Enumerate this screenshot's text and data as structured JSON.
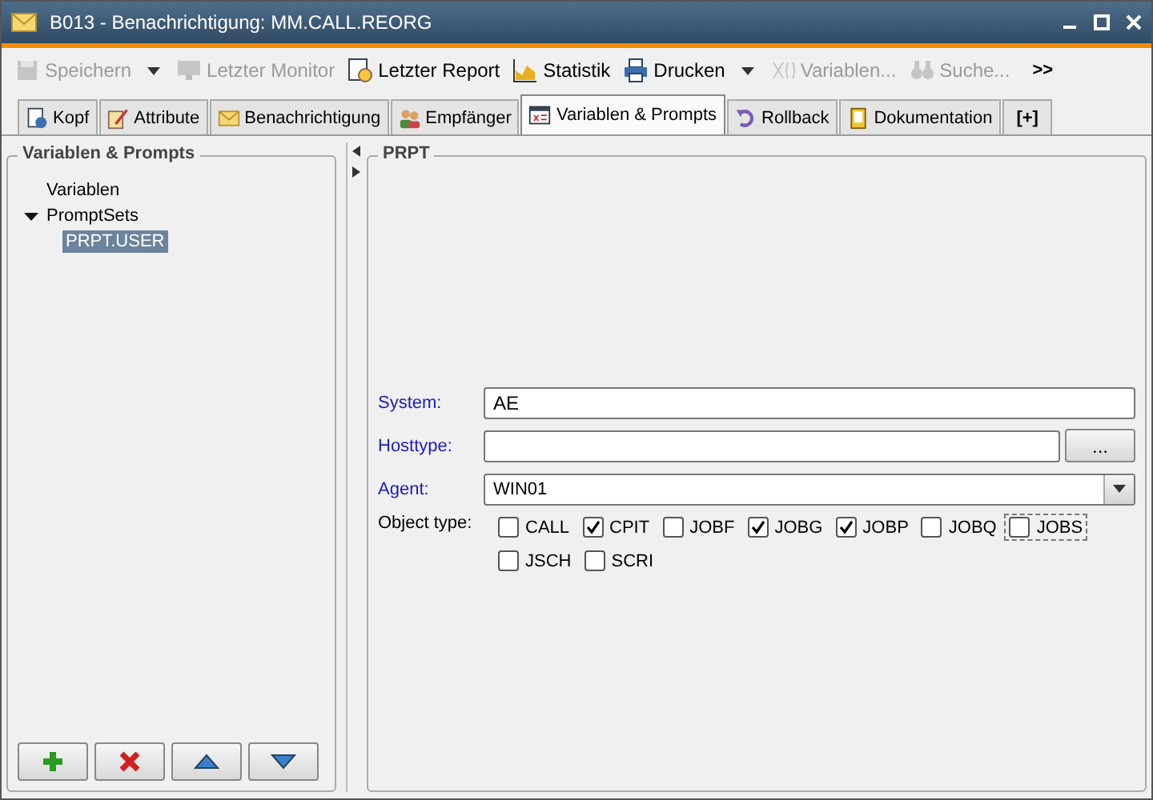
{
  "window": {
    "title": "B013 - Benachrichtigung: MM.CALL.REORG"
  },
  "toolbar": [
    {
      "kind": "button",
      "label": "Speichern",
      "disabled": true
    },
    {
      "kind": "dropdown"
    },
    {
      "kind": "button",
      "label": "Letzter Monitor",
      "disabled": true
    },
    {
      "kind": "button",
      "label": "Letzter Report",
      "disabled": false
    },
    {
      "kind": "button",
      "label": "Statistik",
      "disabled": false
    },
    {
      "kind": "button",
      "label": "Drucken",
      "disabled": false
    },
    {
      "kind": "dropdown"
    },
    {
      "kind": "button",
      "label": "Variablen...",
      "disabled": true
    },
    {
      "kind": "button",
      "label": "Suche...",
      "disabled": true
    },
    {
      "kind": "overflow",
      "label": ">>"
    }
  ],
  "tabs": [
    {
      "label": "Kopf",
      "selected": false
    },
    {
      "label": "Attribute",
      "selected": false
    },
    {
      "label": "Benachrichtigung",
      "selected": false
    },
    {
      "label": "Empfänger",
      "selected": false
    },
    {
      "label": "Variablen & Prompts",
      "selected": true
    },
    {
      "label": "Rollback",
      "selected": false
    },
    {
      "label": "Dokumentation",
      "selected": false
    },
    {
      "label": "[+]",
      "selected": false
    }
  ],
  "left_panel": {
    "title": "Variablen & Prompts",
    "tree": [
      {
        "label": "Variablen",
        "selected": false
      },
      {
        "label": "PromptSets",
        "selected": false,
        "expanded": true,
        "children": [
          {
            "label": "PRPT.USER",
            "selected": true
          }
        ]
      }
    ]
  },
  "right_panel": {
    "title": "PRPT",
    "fields": [
      {
        "kind": "text",
        "label": "System:",
        "value": "AE"
      },
      {
        "kind": "browse",
        "label": "Hosttype:",
        "button": "..."
      },
      {
        "kind": "dropdown",
        "label": "Agent:",
        "value": "WIN01"
      }
    ],
    "object_type": {
      "label": "Object type:",
      "options": [
        {
          "label": "CALL",
          "checked": false,
          "focused": false
        },
        {
          "label": "CPIT",
          "checked": true,
          "focused": false
        },
        {
          "label": "JOBF",
          "checked": false,
          "focused": false
        },
        {
          "label": "JOBG",
          "checked": true,
          "focused": false
        },
        {
          "label": "JOBP",
          "checked": true,
          "focused": false
        },
        {
          "label": "JOBQ",
          "checked": false,
          "focused": false
        },
        {
          "label": "JOBS",
          "checked": false,
          "focused": true
        },
        {
          "label": "JSCH",
          "checked": false,
          "focused": false
        },
        {
          "label": "SCRI",
          "checked": false,
          "focused": false
        }
      ]
    }
  }
}
